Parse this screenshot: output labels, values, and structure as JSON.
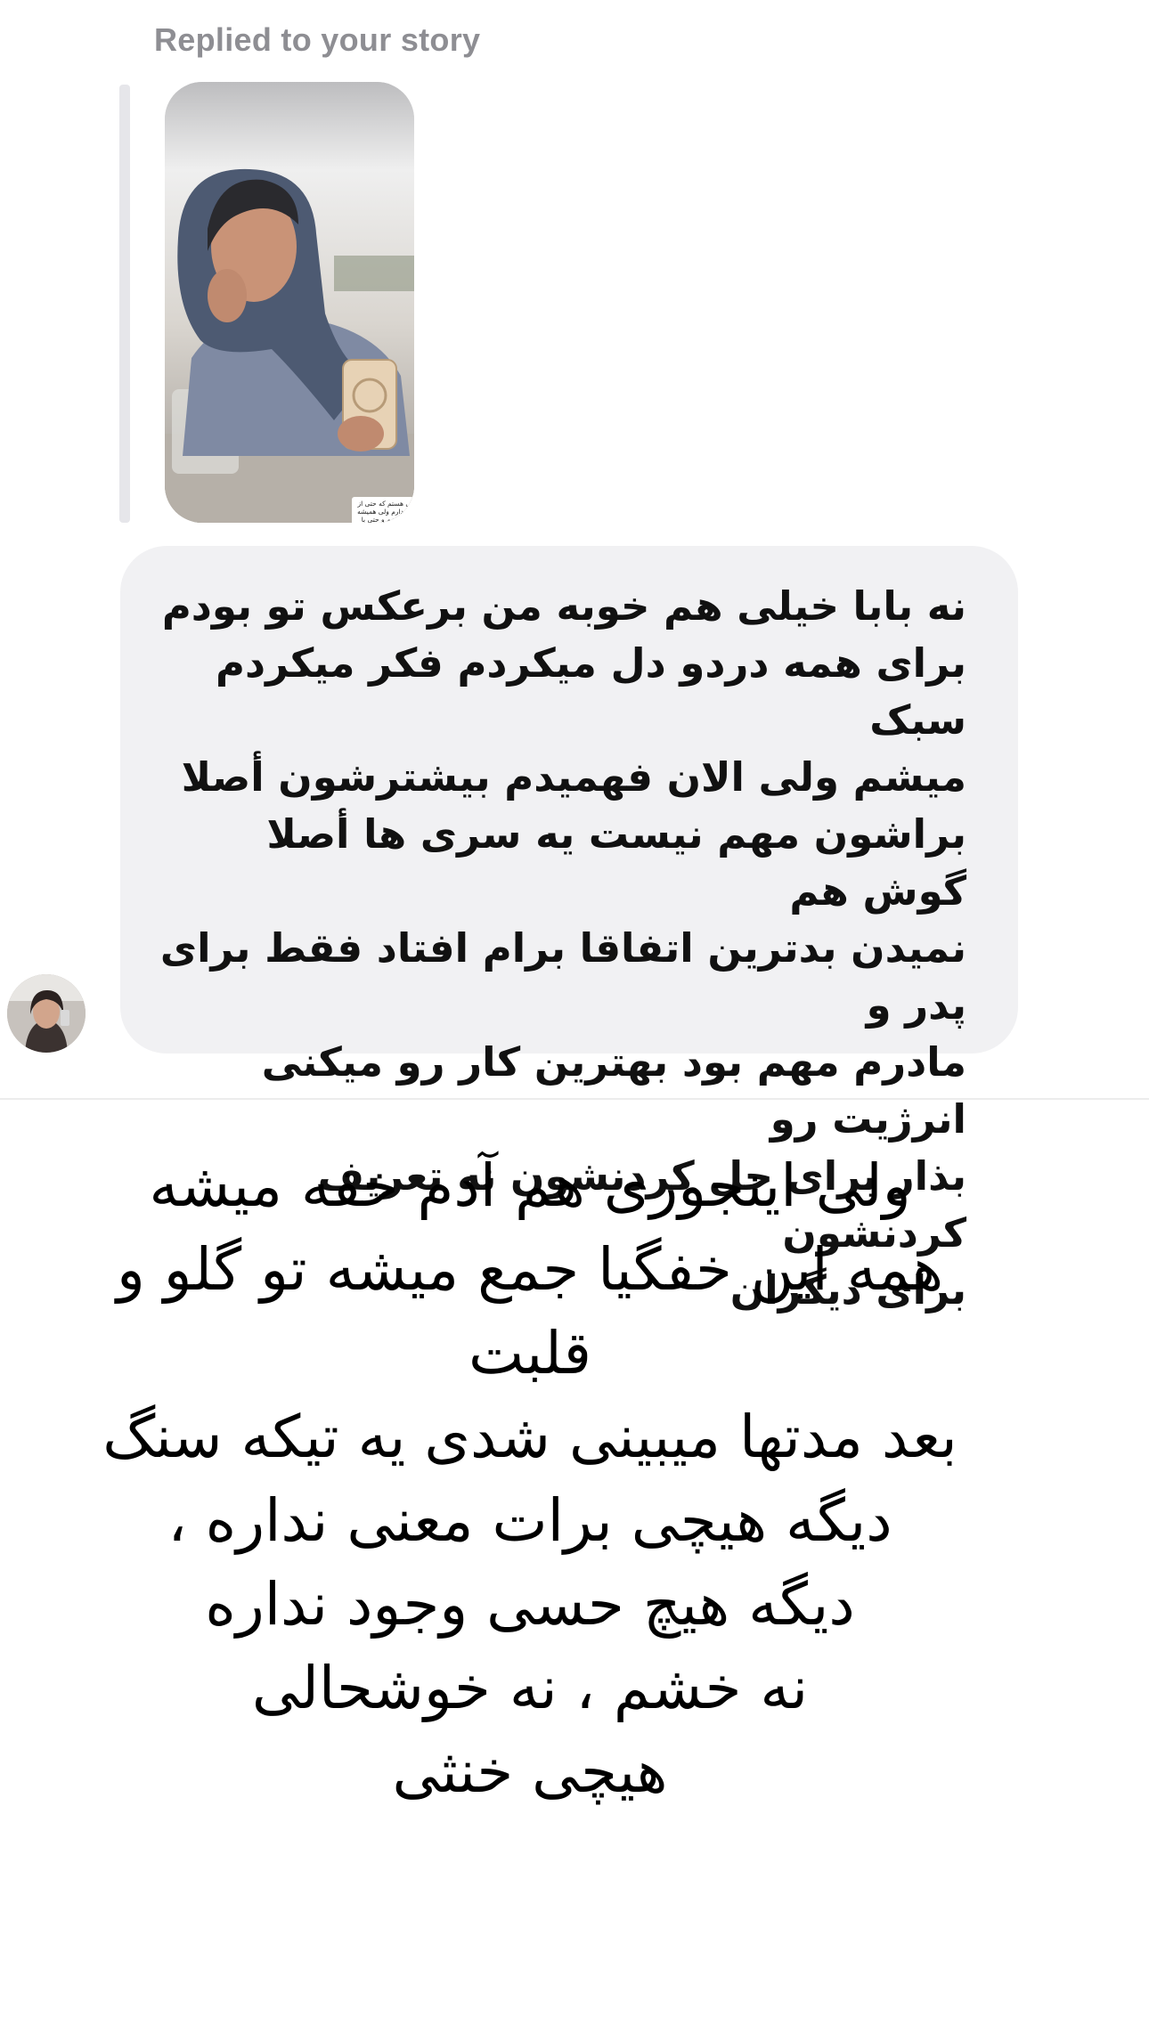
{
  "header": {
    "replied_label": "Replied to your story"
  },
  "story": {
    "caption": "یه وقتایی یا کلیه از مشکلاتی هستم که حتی از به زبون آوردنشون هم واهمه دارم ولی همیشه سعی کردم همه رو تو خودم بریزم و حتی با کسی درددل هم نکنم و راجع به مشکلاتم با کسی حتی حرف نزنم به نظرم این بزرگترین باگ منفی خصوصیات اخلاقیمه"
  },
  "message": {
    "text": "نه بابا خیلی هم خوبه من برعکس تو بودم\nبرای همه دردو دل میکردم فکر میکردم سبک\nمیشم ولی الان فهمیدم بیشترشون أصلا\nبراشون مهم نیست یه سری ها أصلا گوش هم\nنمیدن بدترین اتفاقا برام افتاد فقط برای پدر و\nمادرم مهم بود بهترین کار رو میکنی انرژیت رو\nبذار برای حل کردنشون نه تعریف کردنشون\nبرای دیگران"
  },
  "overlay": {
    "text": "ولی اینجوری هم آدم خفه میشه\nهمه این خفگیا جمع میشه تو گلو و\nقلبت\nبعد مدتها میبینی شدی یه تیکه سنگ\nدیگه هیچی برات معنی نداره ،\nدیگه هیچ حسی وجود نداره\nنه خشم ، نه خوشحالی\nهیچی خنثی"
  },
  "colors": {
    "bubble_bg": "#f1f1f3",
    "label_gray": "#8e8e93",
    "reply_bar": "#e6e6ea"
  }
}
